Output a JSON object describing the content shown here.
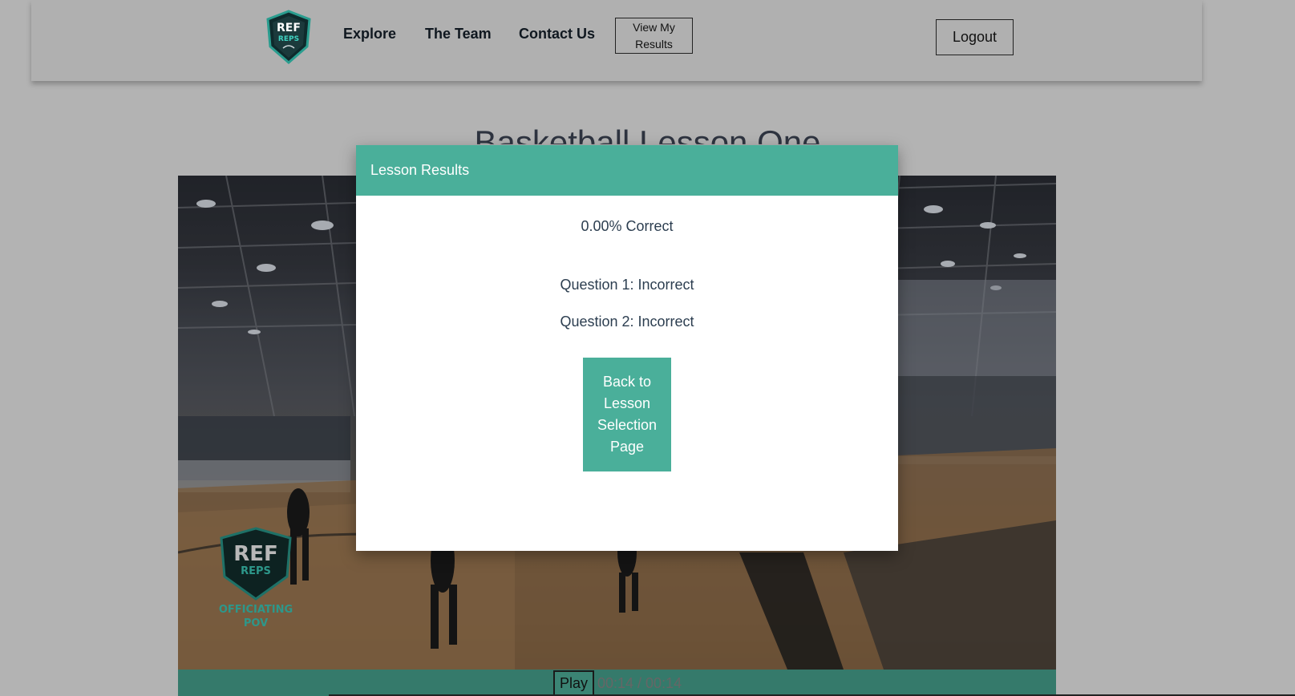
{
  "nav": {
    "explore": "Explore",
    "team": "The Team",
    "contact": "Contact Us",
    "view_results": "View My Results",
    "logout": "Logout",
    "logo_text": [
      "REF",
      "REPS"
    ]
  },
  "page": {
    "title": "Basketball Lesson One"
  },
  "modal": {
    "title": "Lesson Results",
    "score": "0.00% Correct",
    "questions": [
      "Question 1: Incorrect",
      "Question 2: Incorrect"
    ],
    "back_button": "Back to Lesson Selection Page"
  },
  "video": {
    "play_label": "Play",
    "time": "00:14 / 00:14",
    "watermark": [
      "REF",
      "REPS",
      "OFFICIATING",
      "POV"
    ]
  },
  "colors": {
    "accent": "#4aaf9a",
    "controls": "#357a6b",
    "logo_teal": "#2a9d8f"
  }
}
